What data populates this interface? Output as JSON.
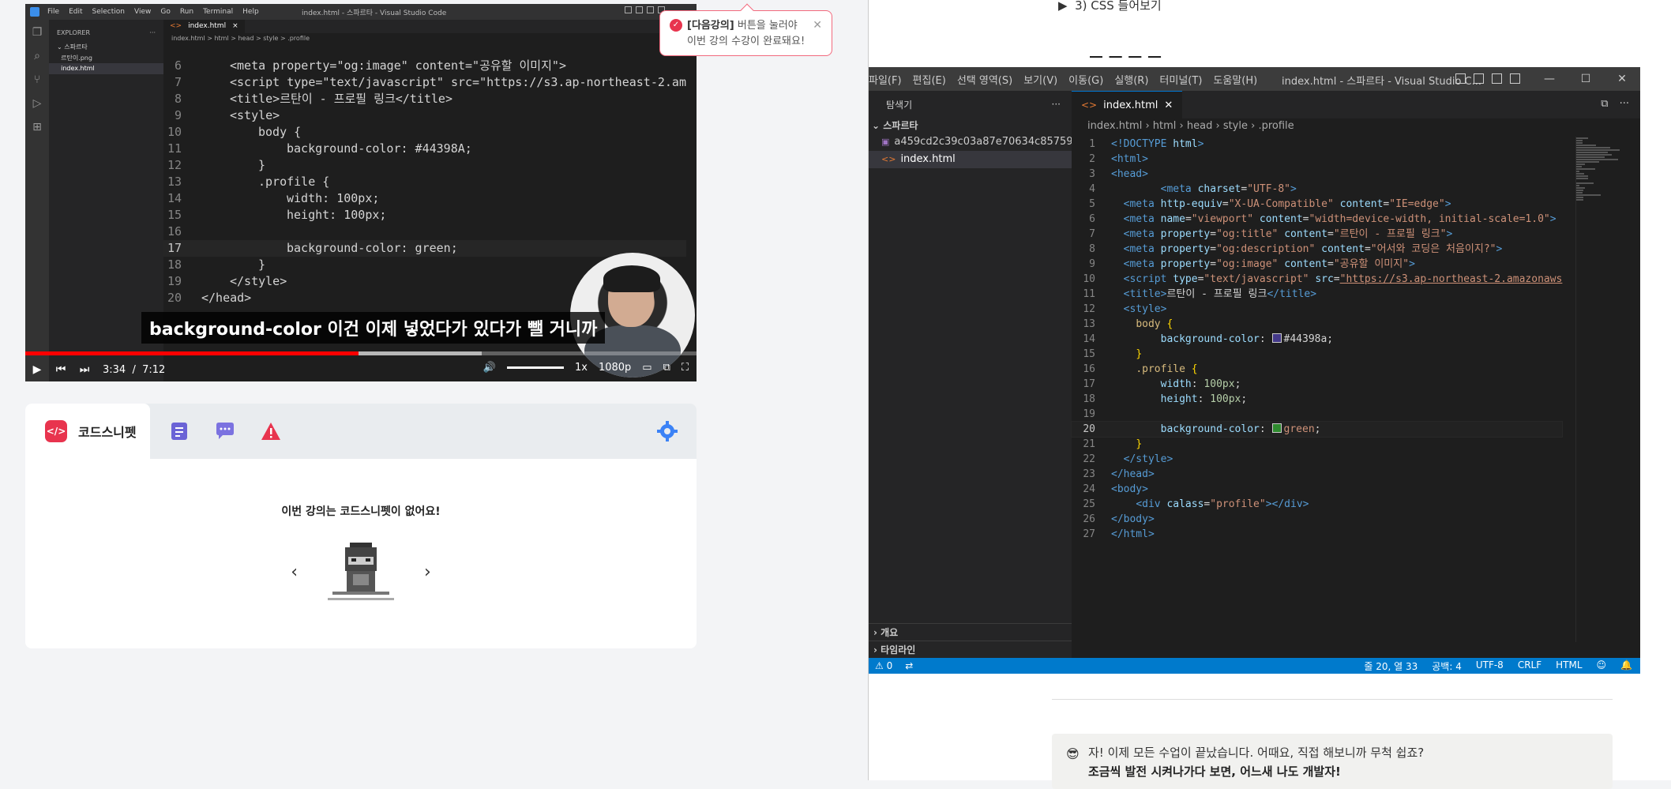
{
  "toast": {
    "bold": "[다음강의]",
    "line1": " 버튼을 눌러야",
    "line2": "이번 강의 수강이 완료돼요!"
  },
  "video": {
    "window_title": "index.html - 스파르타 - Visual Studio Code",
    "menu": [
      "File",
      "Edit",
      "Selection",
      "View",
      "Go",
      "Run",
      "Terminal",
      "Help"
    ],
    "explorer_label": "EXPLORER",
    "folder": "스파르타",
    "files": [
      "르탄이.png",
      "index.html"
    ],
    "tab": "index.html",
    "breadcrumb": "index.html > html > head > style > .profile",
    "current_line": "17",
    "subtitle": "background-color 이건 이제 넣었다가 있다가 뺄 거니까",
    "time_current": "3:34",
    "time_sep": "/",
    "time_total": "7:12",
    "progress_fraction": 0.496,
    "buffered_fraction": 0.68,
    "speed": "1x",
    "quality": "1080p",
    "code": [
      {
        "n": "6",
        "t": "<meta property=\"og:image\" content=\"공유할 이미지\">",
        "i": 4
      },
      {
        "n": "7",
        "t": "<script type=\"text/javascript\" src=\"https://s3.ap-northeast-2.am",
        "i": 4
      },
      {
        "n": "8",
        "t": "<title>르탄이 - 프로필 링크</title>",
        "i": 4
      },
      {
        "n": "9",
        "t": "<style>",
        "i": 4
      },
      {
        "n": "10",
        "t": "body {",
        "i": 8
      },
      {
        "n": "11",
        "t": "background-color: #44398A;",
        "i": 12,
        "sw": "#44398A"
      },
      {
        "n": "12",
        "t": "}",
        "i": 8
      },
      {
        "n": "13",
        "t": ".profile {",
        "i": 8
      },
      {
        "n": "14",
        "t": "width: 100px;",
        "i": 12
      },
      {
        "n": "15",
        "t": "height: 100px;",
        "i": 12
      },
      {
        "n": "16",
        "t": "",
        "i": 0
      },
      {
        "n": "17",
        "t": "background-color: green;",
        "i": 12,
        "sw": "#2e8b2e"
      },
      {
        "n": "18",
        "t": "}",
        "i": 8
      },
      {
        "n": "19",
        "t": "</style>",
        "i": 4
      },
      {
        "n": "20",
        "t": "</head>",
        "i": 0
      }
    ]
  },
  "snippet": {
    "tab_label": "코드스니펫",
    "logo_text": "</>",
    "empty_message": "이번 강의는 코드스니펫이 없어요!",
    "prev": "‹",
    "next": "›"
  },
  "right": {
    "bullet": "3) CSS 들어보기",
    "vscode": {
      "menu": [
        "파일(F)",
        "편집(E)",
        "선택 영역(S)",
        "보기(V)",
        "이동(G)",
        "실행(R)",
        "터미널(T)",
        "도움말(H)"
      ],
      "title": "index.html - 스파르타 - Visual Studio C...",
      "explorer": "탐색기",
      "folder": "스파르타",
      "files": [
        "a459cd2c39c03a87e70634c85759e2c...",
        "index.html"
      ],
      "outline": "개요",
      "timeline": "타임라인",
      "tab": "index.html",
      "breadcrumb": [
        "index.html",
        "html",
        "head",
        "style",
        ".profile"
      ],
      "current_line": "20",
      "status": {
        "problems": "⚠ 0",
        "pos": "줄 20, 열 33",
        "spaces": "공백: 4",
        "enc": "UTF-8",
        "eol": "CRLF",
        "lang": "HTML"
      },
      "code": [
        {
          "n": "1",
          "h": "<span class='t-tag'>&lt;!DOCTYPE</span> <span class='t-attr'>html</span><span class='t-tag'>&gt;</span>"
        },
        {
          "n": "2",
          "h": "<span class='t-tag'>&lt;html&gt;</span>"
        },
        {
          "n": "3",
          "h": "<span class='t-tag'>&lt;head&gt;</span>"
        },
        {
          "n": "4",
          "h": "        <span class='t-tag'>&lt;meta</span> <span class='t-attr'>charset</span>=<span class='t-str'>\"UTF-8\"</span><span class='t-tag'>&gt;</span>"
        },
        {
          "n": "5",
          "h": "  <span class='t-tag'>&lt;meta</span> <span class='t-attr'>http-equiv</span>=<span class='t-str'>\"X-UA-Compatible\"</span> <span class='t-attr'>content</span>=<span class='t-str'>\"IE=edge\"</span><span class='t-tag'>&gt;</span>"
        },
        {
          "n": "6",
          "h": "  <span class='t-tag'>&lt;meta</span> <span class='t-attr'>name</span>=<span class='t-str'>\"viewport\"</span> <span class='t-attr'>content</span>=<span class='t-str'>\"width=device-width, initial-scale=1.0\"</span><span class='t-tag'>&gt;</span>"
        },
        {
          "n": "7",
          "h": "  <span class='t-tag'>&lt;meta</span> <span class='t-attr'>property</span>=<span class='t-str'>\"og:title\"</span> <span class='t-attr'>content</span>=<span class='t-str'>\"르탄이 - 프로필 링크\"</span><span class='t-tag'>&gt;</span>"
        },
        {
          "n": "8",
          "h": "  <span class='t-tag'>&lt;meta</span> <span class='t-attr'>property</span>=<span class='t-str'>\"og:description\"</span> <span class='t-attr'>content</span>=<span class='t-str'>\"어서와 코딩은 처음이지?\"</span><span class='t-tag'>&gt;</span>"
        },
        {
          "n": "9",
          "h": "  <span class='t-tag'>&lt;meta</span> <span class='t-attr'>property</span>=<span class='t-str'>\"og:image\"</span> <span class='t-attr'>content</span>=<span class='t-str'>\"공유할 이미지\"</span><span class='t-tag'>&gt;</span>"
        },
        {
          "n": "10",
          "h": "  <span class='t-tag'>&lt;script</span> <span class='t-attr'>type</span>=<span class='t-str'>\"text/javascript\"</span> <span class='t-attr'>src</span>=<span class='t-link'>\"https://s3.ap-northeast-2.amazonaws</span>"
        },
        {
          "n": "11",
          "h": "  <span class='t-tag'>&lt;title&gt;</span>르탄이 - 프로필 링크<span class='t-tag'>&lt;/title&gt;</span>"
        },
        {
          "n": "12",
          "h": "  <span class='t-tag'>&lt;style&gt;</span>"
        },
        {
          "n": "13",
          "h": "    <span class='t-sel'>body</span> <span class='t-br'>{</span>"
        },
        {
          "n": "14",
          "h": "        <span class='t-prop'>background-color</span>: <span class='sw' style='background:#44398a'></span>#44398a;"
        },
        {
          "n": "15",
          "h": "    <span class='t-br'>}</span>"
        },
        {
          "n": "16",
          "h": "    <span class='t-sel'>.profile</span> <span class='t-br'>{</span>"
        },
        {
          "n": "17",
          "h": "        <span class='t-prop'>width</span>: <span class='t-num'>100px</span>;"
        },
        {
          "n": "18",
          "h": "        <span class='t-prop'>height</span>: <span class='t-num'>100px</span>;"
        },
        {
          "n": "19",
          "h": ""
        },
        {
          "n": "20",
          "h": "        <span class='t-prop'>background-color</span>: <span class='sw' style='background:#2e8b2e'></span><span class='t-str'>green</span>;"
        },
        {
          "n": "21",
          "h": "    <span class='t-br'>}</span>"
        },
        {
          "n": "22",
          "h": "  <span class='t-tag'>&lt;/style&gt;</span>"
        },
        {
          "n": "23",
          "h": "<span class='t-tag'>&lt;/head&gt;</span>"
        },
        {
          "n": "24",
          "h": "<span class='t-tag'>&lt;body&gt;</span>"
        },
        {
          "n": "25",
          "h": "    <span class='t-tag'>&lt;div</span> <span class='t-attr'>calass</span>=<span class='t-str'>\"profile\"</span><span class='t-tag'>&gt;&lt;/div&gt;</span>"
        },
        {
          "n": "26",
          "h": "<span class='t-tag'>&lt;/body&gt;</span>"
        },
        {
          "n": "27",
          "h": "<span class='t-tag'>&lt;/html&gt;</span>"
        }
      ]
    },
    "callout": {
      "emoji": "😎",
      "line1": "자! 이제 모든 수업이 끝났습니다. 어때요, 직접 해보니까 무척 쉽죠?",
      "line2": "조금씩 발전 시켜나가다 보면, 어느새 나도 개발자!"
    }
  }
}
